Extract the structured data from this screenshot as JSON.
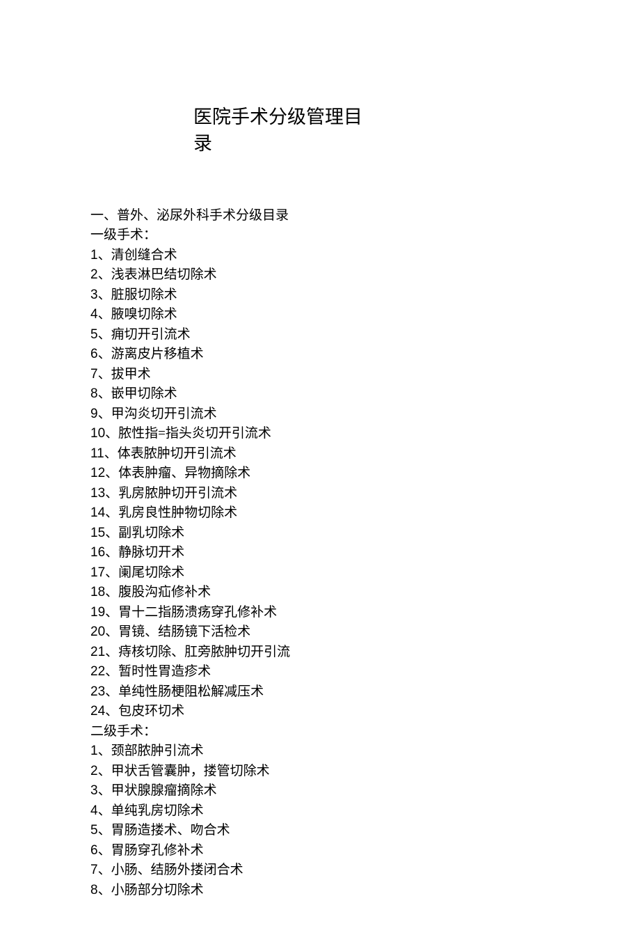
{
  "title_line1": "医院手术分级管理目",
  "title_line2": "录",
  "section_heading": "一、普外、泌尿外科手术分级目录",
  "level1_heading": "一级手术：",
  "level1_items": [
    {
      "num": "1",
      "text": "、清创缝合术"
    },
    {
      "num": "2",
      "text": "、浅表淋巴结切除术"
    },
    {
      "num": "3",
      "text": "、脏服切除术"
    },
    {
      "num": "4",
      "text": "、腋嗅切除术"
    },
    {
      "num": "5",
      "text": "、痈切开引流术"
    },
    {
      "num": "6",
      "text": "、游离皮片移植术"
    },
    {
      "num": "7",
      "text": "、拔甲术"
    },
    {
      "num": "8",
      "text": "、嵌甲切除术"
    },
    {
      "num": "9",
      "text": "、甲沟炎切开引流术"
    },
    {
      "num": "10",
      "text": "、脓性指=指头炎切开引流术"
    },
    {
      "num": "11",
      "text": "、体表脓肿切开引流术"
    },
    {
      "num": "12",
      "text": "、体表肿瘤、异物摘除术"
    },
    {
      "num": "13",
      "text": "、乳房脓肿切开引流术"
    },
    {
      "num": "14",
      "text": "、乳房良性肿物切除术"
    },
    {
      "num": "15",
      "text": "、副乳切除术"
    },
    {
      "num": "16",
      "text": "、静脉切开术"
    },
    {
      "num": "17",
      "text": "、阑尾切除术"
    },
    {
      "num": "18",
      "text": "、腹股沟疝修补术"
    },
    {
      "num": "19",
      "text": "、胃十二指肠溃疡穿孔修补术"
    },
    {
      "num": "20",
      "text": "、胃镜、结肠镜下活检术"
    },
    {
      "num": "21",
      "text": "、痔核切除、肛旁脓肿切开引流"
    },
    {
      "num": "22",
      "text": "、暂时性胃造疹术"
    },
    {
      "num": "23",
      "text": "、单纯性肠梗阻松解减压术"
    },
    {
      "num": "24",
      "text": "、包皮环切术"
    }
  ],
  "level2_heading": "二级手术：",
  "level2_items": [
    {
      "num": "1",
      "text": "、颈部脓肿引流术"
    },
    {
      "num": "2",
      "text": "、甲状舌管囊肿，搂管切除术"
    },
    {
      "num": "3",
      "text": "、甲状腺腺瘤摘除术"
    },
    {
      "num": "4",
      "text": "、单纯乳房切除术"
    },
    {
      "num": "5",
      "text": "、胃肠造搂术、吻合术"
    },
    {
      "num": "6",
      "text": "、胃肠穿孔修补术"
    },
    {
      "num": "7",
      "text": "、小肠、结肠外搂闭合术"
    },
    {
      "num": "8",
      "text": "、小肠部分切除术"
    }
  ]
}
